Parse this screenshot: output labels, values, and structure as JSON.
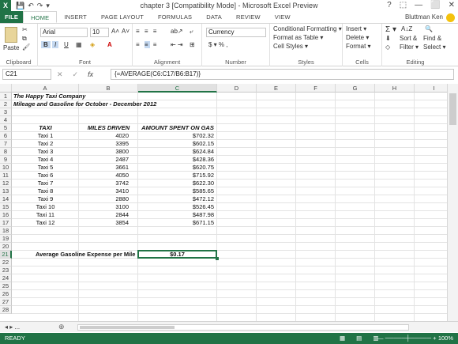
{
  "window": {
    "title": "chapter 3  [Compatibility Mode] - Microsoft Excel Preview",
    "app_icon": "X",
    "controls": [
      "?",
      "⬚",
      "—",
      "⬜",
      "✕"
    ]
  },
  "tabs": [
    "FILE",
    "HOME",
    "INSERT",
    "PAGE LAYOUT",
    "FORMULAS",
    "DATA",
    "REVIEW",
    "VIEW"
  ],
  "active_tab": "HOME",
  "user": "Bluttman Ken",
  "ribbon": {
    "clipboard": {
      "paste": "Paste",
      "label": "Clipboard"
    },
    "font": {
      "name": "Arial",
      "size": "10",
      "bold": "B",
      "italic": "I",
      "underline": "U",
      "label": "Font",
      "grow": "A˄",
      "shrink": "A˅"
    },
    "alignment": {
      "label": "Alignment"
    },
    "number": {
      "format": "Currency",
      "symbols": "$ ▾ %  ,",
      "label": "Number"
    },
    "styles": {
      "items": [
        "Conditional Formatting ▾",
        "Format as Table ▾",
        "Cell Styles ▾"
      ],
      "label": "Styles"
    },
    "cells": {
      "items": [
        "Insert ▾",
        "Delete ▾",
        "Format ▾"
      ],
      "label": "Cells"
    },
    "editing": {
      "sigma": "Σ ▾",
      "sort": "Sort &",
      "filter": "Filter ▾",
      "find": "Find &",
      "select": "Select ▾",
      "label": "Editing"
    }
  },
  "formula_bar": {
    "name_box": "C21",
    "fx": "fx",
    "cancel": "✕",
    "enter": "✓",
    "formula": "{=AVERAGE(C6:C17/B6:B17)}"
  },
  "columns": [
    "A",
    "B",
    "C",
    "D",
    "E",
    "F",
    "G",
    "H",
    "I",
    "J"
  ],
  "rows": [
    "1",
    "2",
    "3",
    "4",
    "5",
    "6",
    "7",
    "8",
    "9",
    "10",
    "11",
    "12",
    "13",
    "14",
    "15",
    "16",
    "17",
    "18",
    "19",
    "20",
    "21",
    "22",
    "23",
    "24",
    "25",
    "26",
    "27",
    "28"
  ],
  "sheet": {
    "title1": "The Happy Taxi Company",
    "title2": "Mileage and Gasoline for October - December 2012",
    "headers": [
      "TAXI",
      "MILES DRIVEN",
      "AMOUNT SPENT ON GAS"
    ],
    "data": [
      [
        "Taxi 1",
        "4020",
        "$702.32"
      ],
      [
        "Taxi 2",
        "3395",
        "$602.15"
      ],
      [
        "Taxi 3",
        "3800",
        "$624.84"
      ],
      [
        "Taxi 4",
        "2487",
        "$428.36"
      ],
      [
        "Taxi 5",
        "3661",
        "$620.75"
      ],
      [
        "Taxi 6",
        "4050",
        "$715.92"
      ],
      [
        "Taxi 7",
        "3742",
        "$622.30"
      ],
      [
        "Taxi 8",
        "3410",
        "$585.65"
      ],
      [
        "Taxi 9",
        "2880",
        "$472.12"
      ],
      [
        "Taxi 10",
        "3100",
        "$526.45"
      ],
      [
        "Taxi 11",
        "2844",
        "$487.98"
      ],
      [
        "Taxi 12",
        "3854",
        "$671.15"
      ]
    ],
    "summary_label": "Average Gasoline Expense per Mile Driven:",
    "summary_value": "$0.17"
  },
  "sheet_tabs": {
    "nav": "◂ ▸  ...",
    "more": "...",
    "add": "⊕"
  },
  "status": {
    "ready": "READY",
    "zoom": "100%"
  },
  "colors": {
    "accent": "#217346"
  }
}
